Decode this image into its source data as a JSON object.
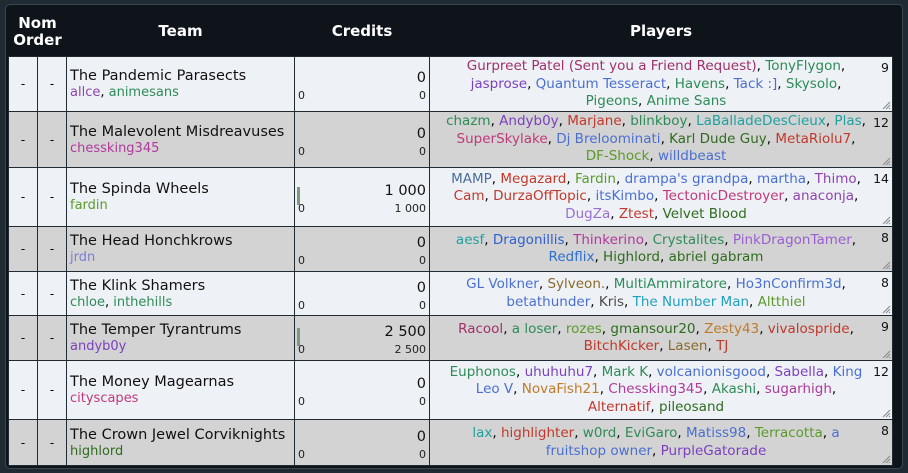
{
  "headers": {
    "nom": "Nom Order",
    "team": "Team",
    "credits": "Credits",
    "players": "Players"
  },
  "nom_placeholder": "-",
  "teams": [
    {
      "name": "The Pandemic Parasects",
      "managers": [
        {
          "n": "allce",
          "c": "#8e44ad"
        },
        {
          "n": "animesans",
          "c": "#2e8b57"
        }
      ],
      "credits": "0",
      "credits_sub": "0",
      "credits_left": "0",
      "count": "9",
      "bar": 0,
      "players": [
        {
          "n": "Gurpreet Patel (Sent you a Friend Request)",
          "c": "#a0306a"
        },
        {
          "n": "TonyFlygon",
          "c": "#2e8b57"
        },
        {
          "n": "jasprose",
          "c": "#7b3fbf"
        },
        {
          "n": "Quantum Tesseract",
          "c": "#4a6fd1"
        },
        {
          "n": "Havens",
          "c": "#2e8b57"
        },
        {
          "n": "Tack :]",
          "c": "#4a6fd1"
        },
        {
          "n": "Skysolo",
          "c": "#2e8b57"
        },
        {
          "n": "Pigeons",
          "c": "#2e8b57"
        },
        {
          "n": "Anime Sans",
          "c": "#2e8b57"
        }
      ]
    },
    {
      "name": "The Malevolent Misdreavuses",
      "managers": [
        {
          "n": "chessking345",
          "c": "#b0399b"
        }
      ],
      "credits": "0",
      "credits_sub": "0",
      "credits_left": "0",
      "count": "12",
      "bar": 0,
      "players": [
        {
          "n": "chazm",
          "c": "#2e8b57"
        },
        {
          "n": "Andyb0y",
          "c": "#7b3fbf"
        },
        {
          "n": "Marjane",
          "c": "#c0392b"
        },
        {
          "n": "blinkboy",
          "c": "#2e8b57"
        },
        {
          "n": "LaBalladeDesCieux",
          "c": "#20a0a0"
        },
        {
          "n": "Plas",
          "c": "#20a0a0"
        },
        {
          "n": "SuperSkylake",
          "c": "#c0397b"
        },
        {
          "n": "Dj Breloominati",
          "c": "#4a6fd1"
        },
        {
          "n": "Karl Dude Guy",
          "c": "#2e6b1e"
        },
        {
          "n": "MetaRiolu7",
          "c": "#c0392b"
        },
        {
          "n": "DF-Shock",
          "c": "#5a9a2a"
        },
        {
          "n": "willdbeast",
          "c": "#4a6fd1"
        }
      ]
    },
    {
      "name": "The Spinda Wheels",
      "managers": [
        {
          "n": "fardin",
          "c": "#5a9a2a"
        }
      ],
      "credits": "1 000",
      "credits_sub": "1 000",
      "credits_left": "0",
      "count": "14",
      "bar": 1,
      "players": [
        {
          "n": "MAMP",
          "c": "#4a6f9a"
        },
        {
          "n": "Megazard",
          "c": "#c0392b"
        },
        {
          "n": "Fardin",
          "c": "#5a9a2a"
        },
        {
          "n": "drampa's grandpa",
          "c": "#4a6fd1"
        },
        {
          "n": "martha",
          "c": "#4a6fd1"
        },
        {
          "n": "Thimo",
          "c": "#8e44ad"
        },
        {
          "n": "Cam",
          "c": "#c0392b"
        },
        {
          "n": "DurzaOffTopic",
          "c": "#c0392b"
        },
        {
          "n": "itsKimbo",
          "c": "#4a6fd1"
        },
        {
          "n": "TectonicDestroyer",
          "c": "#c0397b"
        },
        {
          "n": "anaconja",
          "c": "#8e44ad"
        },
        {
          "n": "DugZa",
          "c": "#9b6fd1"
        },
        {
          "n": "Ztest",
          "c": "#c0392b"
        },
        {
          "n": "Velvet Blood",
          "c": "#2e6b1e"
        }
      ]
    },
    {
      "name": "The Head Honchkrows",
      "managers": [
        {
          "n": "jrdn",
          "c": "#7b7fd1"
        }
      ],
      "credits": "0",
      "credits_sub": "0",
      "credits_left": "0",
      "count": "8",
      "bar": 0,
      "players": [
        {
          "n": "aesf",
          "c": "#20a0a0"
        },
        {
          "n": "Dragonillis",
          "c": "#2e5fd1"
        },
        {
          "n": "Thinkerino",
          "c": "#b0399b"
        },
        {
          "n": "Crystalites",
          "c": "#2e8b57"
        },
        {
          "n": "PinkDragonTamer",
          "c": "#9b5fd1"
        },
        {
          "n": "Redflix",
          "c": "#2e6fd1"
        },
        {
          "n": "Highlord",
          "c": "#2e6b1e"
        },
        {
          "n": "abriel gabram",
          "c": "#2e6b1e"
        }
      ]
    },
    {
      "name": "The Klink Shamers",
      "managers": [
        {
          "n": "chloe",
          "c": "#2e8b57"
        },
        {
          "n": "inthehills",
          "c": "#2e8b57"
        }
      ],
      "credits": "0",
      "credits_sub": "0",
      "credits_left": "0",
      "count": "8",
      "bar": 0,
      "players": [
        {
          "n": "GL Volkner",
          "c": "#4a6fd1"
        },
        {
          "n": "Sylveon.",
          "c": "#8a6a2a"
        },
        {
          "n": "MultiAmmiratore",
          "c": "#2e8b57"
        },
        {
          "n": "Ho3nConfirm3d",
          "c": "#4a6fd1"
        },
        {
          "n": "betathunder",
          "c": "#4a6fd1"
        },
        {
          "n": "Kris",
          "c": "#4a4a4a"
        },
        {
          "n": "The Number Man",
          "c": "#20a0c0"
        },
        {
          "n": "Altthiel",
          "c": "#5a9a2a"
        }
      ]
    },
    {
      "name": "The Temper Tyrantrums",
      "managers": [
        {
          "n": "andyb0y",
          "c": "#7b3fbf"
        }
      ],
      "credits": "2 500",
      "credits_sub": "2 500",
      "credits_left": "0",
      "count": "9",
      "bar": 1,
      "players": [
        {
          "n": "Racool",
          "c": "#a0306a"
        },
        {
          "n": "a loser",
          "c": "#2e8b57"
        },
        {
          "n": "rozes",
          "c": "#5a9a2a"
        },
        {
          "n": "gmansour20",
          "c": "#2e6b1e"
        },
        {
          "n": "Zesty43",
          "c": "#c07a2a"
        },
        {
          "n": "vivalospride",
          "c": "#c0392b"
        },
        {
          "n": "BitchKicker",
          "c": "#c0392b"
        },
        {
          "n": "Lasen",
          "c": "#8a6a2a"
        },
        {
          "n": "TJ",
          "c": "#c0392b"
        }
      ]
    },
    {
      "name": "The Money Magearnas",
      "managers": [
        {
          "n": "cityscapes",
          "c": "#c0397b"
        }
      ],
      "credits": "0",
      "credits_sub": "0",
      "credits_left": "0",
      "count": "12",
      "bar": 0,
      "players": [
        {
          "n": "Euphonos",
          "c": "#2e8b57"
        },
        {
          "n": "uhuhuhu7",
          "c": "#7b3fbf"
        },
        {
          "n": "Mark K",
          "c": "#2e8b57"
        },
        {
          "n": "volcanionisgood",
          "c": "#4a6fd1"
        },
        {
          "n": "Sabella",
          "c": "#7b3fbf"
        },
        {
          "n": "King Leo V",
          "c": "#4a6fd1"
        },
        {
          "n": "NovaFish21",
          "c": "#c07a2a"
        },
        {
          "n": "Chessking345",
          "c": "#b0399b"
        },
        {
          "n": "Akashi",
          "c": "#2e8b57"
        },
        {
          "n": "sugarhigh",
          "c": "#b0399b"
        },
        {
          "n": "Alternatif",
          "c": "#c0392b"
        },
        {
          "n": "pileosand",
          "c": "#2e6b1e"
        }
      ]
    },
    {
      "name": "The Crown Jewel Corviknights",
      "managers": [
        {
          "n": "highlord",
          "c": "#2e6b1e"
        }
      ],
      "credits": "0",
      "credits_sub": "0",
      "credits_left": "0",
      "count": "8",
      "bar": 0,
      "players": [
        {
          "n": "lax",
          "c": "#20a0a0"
        },
        {
          "n": "highlighter",
          "c": "#c0392b"
        },
        {
          "n": "w0rd",
          "c": "#2e8b57"
        },
        {
          "n": "EviGaro",
          "c": "#2e8b57"
        },
        {
          "n": "Matiss98",
          "c": "#4a6fd1"
        },
        {
          "n": "Terracotta",
          "c": "#5a9a2a"
        },
        {
          "n": "a fruitshop owner",
          "c": "#4a6fd1"
        },
        {
          "n": "PurpleGatorade",
          "c": "#7b3fbf"
        }
      ]
    }
  ],
  "colors": {
    "light_row": "#eef2f6",
    "dark_row": "#d3d3d3",
    "header_bg": "#0e1419"
  }
}
